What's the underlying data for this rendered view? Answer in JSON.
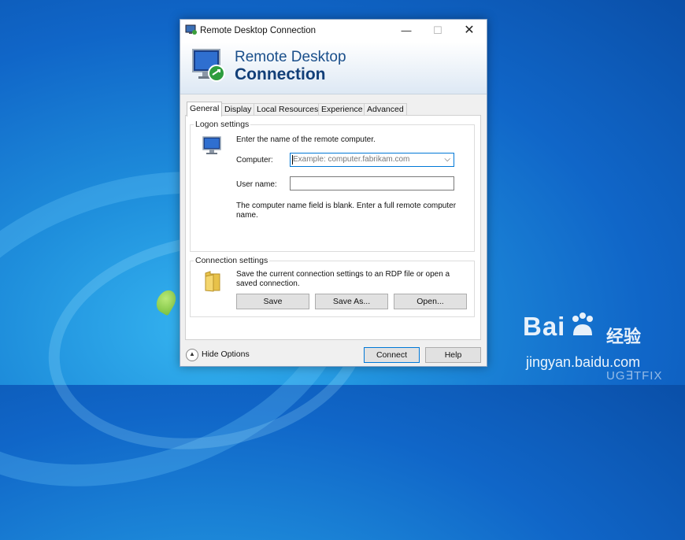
{
  "window": {
    "title": "Remote Desktop Connection",
    "minimize_glyph": "—",
    "maximize_glyph": "☐",
    "close_glyph": "✕"
  },
  "banner": {
    "line1": "Remote Desktop",
    "line2": "Connection"
  },
  "tabs": [
    {
      "label": "General",
      "active": true
    },
    {
      "label": "Display",
      "active": false
    },
    {
      "label": "Local Resources",
      "active": false
    },
    {
      "label": "Experience",
      "active": false
    },
    {
      "label": "Advanced",
      "active": false
    }
  ],
  "logon": {
    "legend": "Logon settings",
    "instruction": "Enter the name of the remote computer.",
    "computer_label": "Computer:",
    "computer_placeholder": "Example: computer.fabrikam.com",
    "computer_value": "",
    "username_label": "User name:",
    "username_value": "",
    "warning": "The computer name field is blank. Enter a full remote computer name."
  },
  "connection": {
    "legend": "Connection settings",
    "description": "Save the current connection settings to an RDP file or open a saved connection.",
    "save_label": "Save",
    "save_as_label": "Save As...",
    "open_label": "Open..."
  },
  "footer": {
    "hide_options_label": "Hide Options",
    "connect_label": "Connect",
    "help_label": "Help"
  },
  "watermark": {
    "baidu_a": "Bai",
    "baidu_b": "经验",
    "url": "jingyan.baidu.com",
    "ugetfix": "UG∃TFIX"
  },
  "icons": [
    "rdp-app-icon",
    "monitor-icon",
    "folder-icon",
    "chevron-down-icon",
    "chevron-up-circle-icon",
    "baidu-paw-icon"
  ]
}
